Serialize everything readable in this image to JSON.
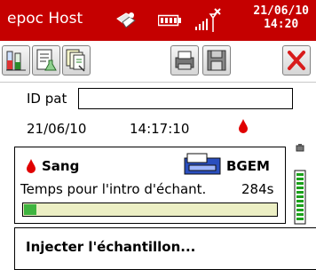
{
  "titlebar": {
    "title": "epoc Host",
    "date": "21/06/10",
    "time": "14:20",
    "bg_color": "#c50000"
  },
  "toolbar": {
    "buttons": [
      {
        "icon": "test-tubes-icon"
      },
      {
        "icon": "flask-document-icon"
      },
      {
        "icon": "card-stack-icon"
      },
      {
        "icon": "printer-icon"
      },
      {
        "icon": "save-icon"
      },
      {
        "icon": "close-x-icon"
      }
    ]
  },
  "patient": {
    "id_label": "ID pat",
    "id_value": "",
    "date": "21/06/10",
    "time": "14:17:10"
  },
  "test": {
    "sample_type": "Sang",
    "reader": "BGEM",
    "timer_label": "Temps pour l'intro d'échant.",
    "timer_value": "284s",
    "progress_fraction": 0.05,
    "progress_color": "#3fb43f"
  },
  "message": {
    "text": "Injecter l'échantillon..."
  }
}
